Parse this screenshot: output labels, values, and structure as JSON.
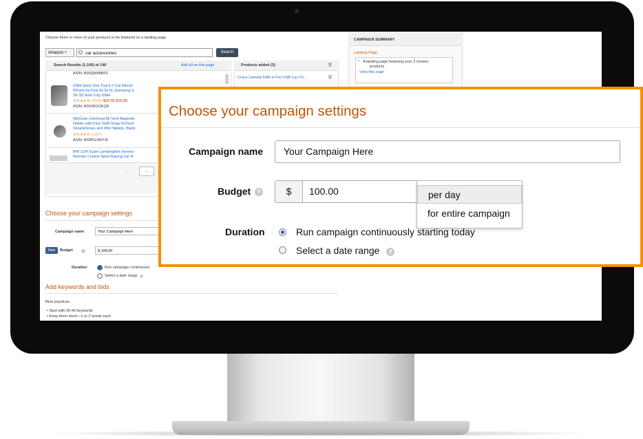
{
  "background_page": {
    "intro": "Choose three or more of your products to be featured on a landing page.",
    "source_select": "Amazon",
    "search_value": "car accessories",
    "search_button": "Search",
    "results_header": "Search Results (1-100) of 146",
    "add_all_link": "Add all on this page",
    "asin_top": "ASIN: B00QM48BF0",
    "results": [
      {
        "title": "iOttie Easy One Touch 2 Car Mount",
        "line2": "iPhone 6s Plus 6s 5s 5c Samsung G",
        "line3": "S6 S5 Note 5 by iOttie",
        "rating": "★★★★★ (3544)",
        "price": "$29.95 $19.95",
        "asin": "ASIN: B00JRGOKQ8"
      },
      {
        "title": "WizGear Universal Air Vent Magnetic",
        "line2": "Holder with Fast Swift-Snap Technol",
        "line3": "Smartphones and Mini Tablets, Black",
        "rating": "★★★★★ (1997)",
        "price": "",
        "asin": "ASIN: B00PGJWYJ0"
      },
      {
        "title": "RW 1/24 Scale Lamborghini Veneno",
        "line2": "Remote Control Sport Racing Car R",
        "line3": "",
        "rating": "",
        "price": "",
        "asin": ""
      }
    ],
    "products_header": "Products added (3)",
    "products": [
      "Crave CarHub 54W 4 Port USB Car Ch..."
    ],
    "summary": {
      "title": "CAMPAIGN SUMMARY",
      "section": "Landing Page",
      "check_text_1": "A landing page featuring your 3 chosen",
      "check_text_2": "products",
      "view_link": "View this page"
    },
    "settings_heading": "Choose your campaign settings",
    "campaign_name_label": "Campaign name",
    "campaign_name_value": "Your Campaign Here",
    "new_badge": "New",
    "budget_label": "Budget",
    "budget_value": "$  100.00",
    "duration_label": "Duration",
    "duration_option_1": "Run campaign continuousl",
    "duration_option_2": "Select a date range",
    "keywords_heading": "Add keywords and bids",
    "best_practices": "Best practices:",
    "bullets": [
      "Start with 30-40 keywords",
      "Keep them short—1 or 2 words each"
    ],
    "pager_prev": "←",
    "pager_next": "→"
  },
  "callout": {
    "title": "Choose your campaign settings",
    "campaign_name_label": "Campaign name",
    "campaign_name_value": "Your Campaign Here",
    "budget_label": "Budget",
    "currency": "$",
    "budget_value": "100.00",
    "budget_options": [
      "per day",
      "for entire campaign"
    ],
    "selected_budget_option": "per day",
    "duration_label": "Duration",
    "duration_options": [
      "Run campaign continuously starting today",
      "Select a date range"
    ],
    "selected_duration_option": "Run campaign continuously starting today"
  },
  "colors": {
    "accent_orange": "#f39200",
    "heading_orange": "#c45500",
    "link_blue": "#1b6ac9",
    "radio_blue": "#2f5ea8"
  },
  "icons": [
    "search-icon",
    "info-icon",
    "radio-selected",
    "radio-unselected",
    "trash-icon",
    "checkmark-icon"
  ]
}
